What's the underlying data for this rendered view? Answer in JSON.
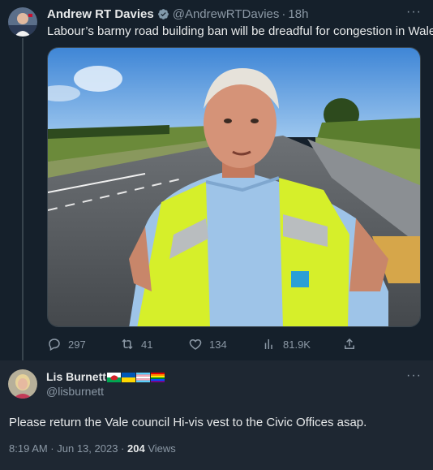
{
  "parent_tweet": {
    "author_name": "Andrew RT Davies",
    "handle": "@AndrewRTDavies",
    "separator": "·",
    "time_ago": "18h",
    "more_label": "···",
    "text": "Labour’s barmy road building ban will be dreadful for congestion in Wales.",
    "media_icon": "photo-road-high-vis-vest",
    "actions": {
      "replies": "297",
      "retweets": "41",
      "likes": "134",
      "views": "81.9K"
    }
  },
  "reply_tweet": {
    "author_name": "Lis Burnett",
    "flags": [
      "wales-flag",
      "ukraine-flag",
      "transgender-flag",
      "rainbow-flag"
    ],
    "handle": "@lisburnett",
    "more_label": "···",
    "text": "Please return the Vale council Hi-vis vest to the Civic Offices asap.",
    "timestamp": "8:19 AM · Jun 13, 2023 ·",
    "views_count": "204",
    "views_label": "Views"
  },
  "colors": {
    "background": "#15202b",
    "reply_background": "#1e2732",
    "text_primary": "#e7e9ea",
    "text_secondary": "#8b98a5",
    "verified_badge": "#829aab",
    "divider": "#38444d"
  }
}
